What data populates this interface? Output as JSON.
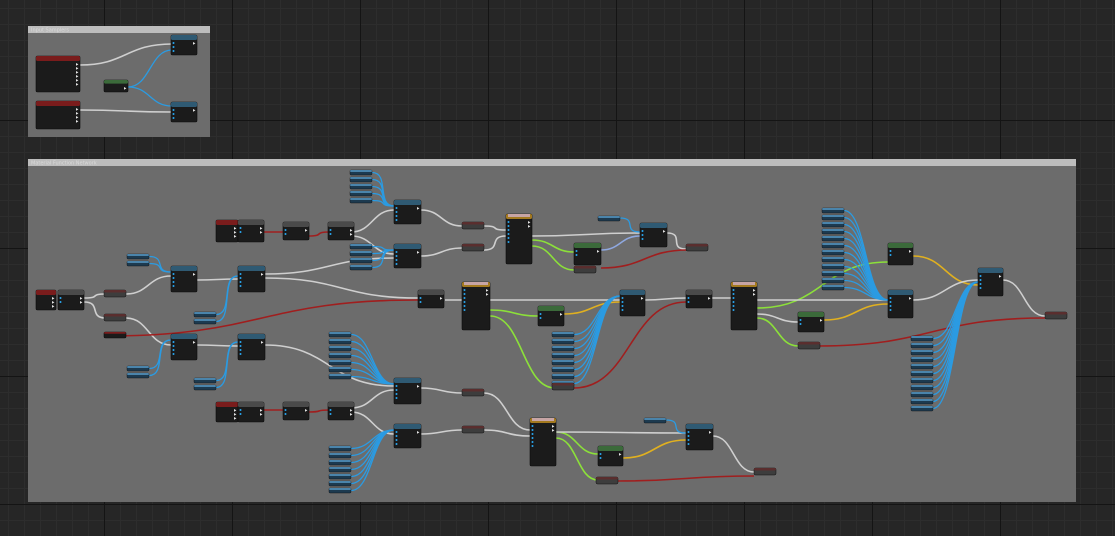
{
  "graph": {
    "comments": [
      {
        "title": "Input Samplers"
      },
      {
        "title": "Material Function Network"
      }
    ]
  },
  "colors": {
    "canvas": "#262626",
    "comment_box": "#6c6c6c",
    "comment_header": "#bdbdbd",
    "node_body": "#1b1b1b",
    "header_blue": "#2f5a73",
    "header_red": "#7a1c1c",
    "header_green": "#3b6a3a",
    "header_gold": "#a3791f",
    "header_gray": "#4a4a4a",
    "header_pink": "#c7a5a5",
    "wire_white": "#cfcfcf",
    "wire_blue": "#2b9be2",
    "wire_green": "#8ce03a",
    "wire_yellow": "#e0b020",
    "wire_red": "#a01e1e",
    "wire_lavender": "#8fa8e0",
    "pin_input": "#29a7f0",
    "pin_output": "#e6e6e6"
  }
}
